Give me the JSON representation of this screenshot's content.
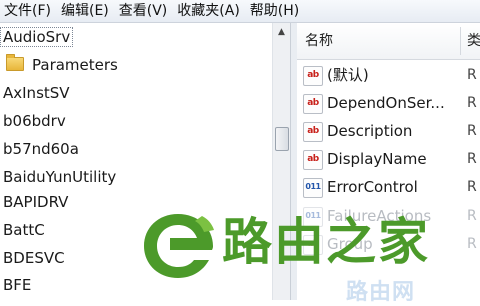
{
  "menubar": {
    "items": [
      "文件(F)",
      "编辑(E)",
      "查看(V)",
      "收藏夹(A)",
      "帮助(H)"
    ]
  },
  "tree": {
    "items": [
      {
        "label": "AudioSrv",
        "selected": true,
        "folder": false
      },
      {
        "label": "Parameters",
        "selected": false,
        "folder": true
      },
      {
        "label": "AxInstSV",
        "selected": false,
        "folder": false
      },
      {
        "label": "b06bdrv",
        "selected": false,
        "folder": false
      },
      {
        "label": "b57nd60a",
        "selected": false,
        "folder": false
      },
      {
        "label": "BaiduYunUtility",
        "selected": false,
        "folder": false
      },
      {
        "label": "BAPIDRV",
        "selected": false,
        "folder": false
      },
      {
        "label": "BattC",
        "selected": false,
        "folder": false
      },
      {
        "label": "BDESVC",
        "selected": false,
        "folder": false
      },
      {
        "label": "BFE",
        "selected": false,
        "folder": false
      }
    ]
  },
  "list": {
    "columns": {
      "name": "名称",
      "type": "类"
    },
    "rows": [
      {
        "icon": "string-value-icon",
        "icon_text": "ab",
        "name": "(默认)",
        "type": "R"
      },
      {
        "icon": "string-value-icon",
        "icon_text": "ab",
        "name": "DependOnSer...",
        "type": "R"
      },
      {
        "icon": "string-value-icon",
        "icon_text": "ab",
        "name": "Description",
        "type": "R"
      },
      {
        "icon": "string-value-icon",
        "icon_text": "ab",
        "name": "DisplayName",
        "type": "R"
      },
      {
        "icon": "binary-value-icon",
        "icon_text": "011",
        "name": "ErrorControl",
        "type": "R"
      },
      {
        "icon": "binary-value-icon",
        "icon_text": "011",
        "name": "FailureActions",
        "type": "R"
      },
      {
        "icon": "string-value-icon",
        "icon_text": "ab",
        "name": "Group",
        "type": "R"
      }
    ]
  },
  "watermark": {
    "text": "路由之家",
    "subtext": "路由网",
    "color": "#4c9a2a"
  }
}
